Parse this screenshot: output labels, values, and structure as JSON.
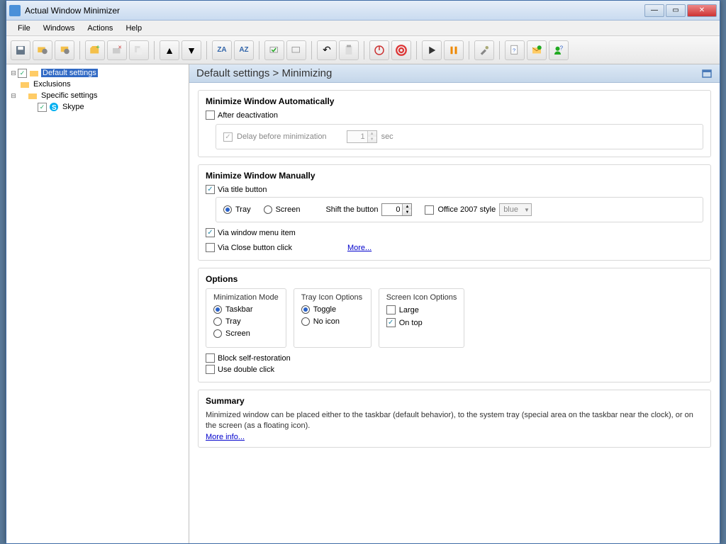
{
  "window": {
    "title": "Actual Window Minimizer"
  },
  "menu": {
    "file": "File",
    "windows": "Windows",
    "actions": "Actions",
    "help": "Help"
  },
  "tree": {
    "default_settings": "Default settings",
    "exclusions": "Exclusions",
    "specific_settings": "Specific settings",
    "skype": "Skype"
  },
  "breadcrumb": "Default settings  >  Minimizing",
  "auto": {
    "title": "Minimize Window Automatically",
    "after_deactivation": "After deactivation",
    "delay_label": "Delay before minimization",
    "delay_value": "1",
    "delay_unit": "sec"
  },
  "manual": {
    "title": "Minimize Window Manually",
    "via_title": "Via title button",
    "tray": "Tray",
    "screen": "Screen",
    "shift_label": "Shift the button",
    "shift_value": "0",
    "office_style": "Office 2007 style",
    "office_color": "blue",
    "via_menu": "Via window menu item",
    "via_close": "Via Close button click",
    "more": "More..."
  },
  "options": {
    "title": "Options",
    "mode_title": "Minimization Mode",
    "mode_taskbar": "Taskbar",
    "mode_tray": "Tray",
    "mode_screen": "Screen",
    "tray_title": "Tray Icon Options",
    "tray_toggle": "Toggle",
    "tray_noicon": "No icon",
    "screen_title": "Screen Icon Options",
    "screen_large": "Large",
    "screen_ontop": "On top",
    "block_self": "Block self-restoration",
    "double_click": "Use double click"
  },
  "summary": {
    "title": "Summary",
    "text": "Minimized window can be placed either to the taskbar (default behavior), to the system tray (special area on the taskbar near the clock), or on the screen (as a floating icon).",
    "more": "More info..."
  }
}
